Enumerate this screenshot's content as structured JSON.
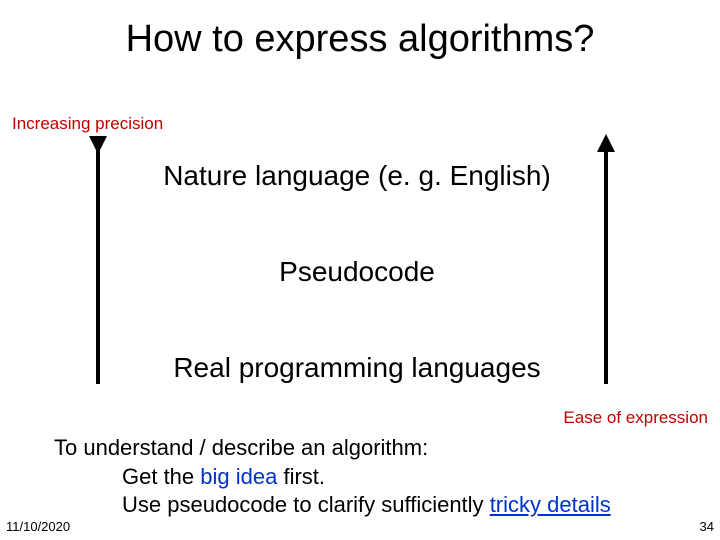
{
  "title": "How to express algorithms?",
  "labels": {
    "precision": "Increasing precision",
    "ease": "Ease of expression"
  },
  "levels": {
    "l1": "Nature language (e. g. English)",
    "l2": "Pseudocode",
    "l3": "Real programming languages"
  },
  "desc": {
    "line1": "To understand / describe an algorithm:",
    "line2a": "Get the ",
    "line2b": "big idea",
    "line2c": " first.",
    "line3a": "Use pseudocode to clarify sufficiently ",
    "line3b": "tricky details"
  },
  "footer": {
    "date": "11/10/2020",
    "page": "34"
  }
}
